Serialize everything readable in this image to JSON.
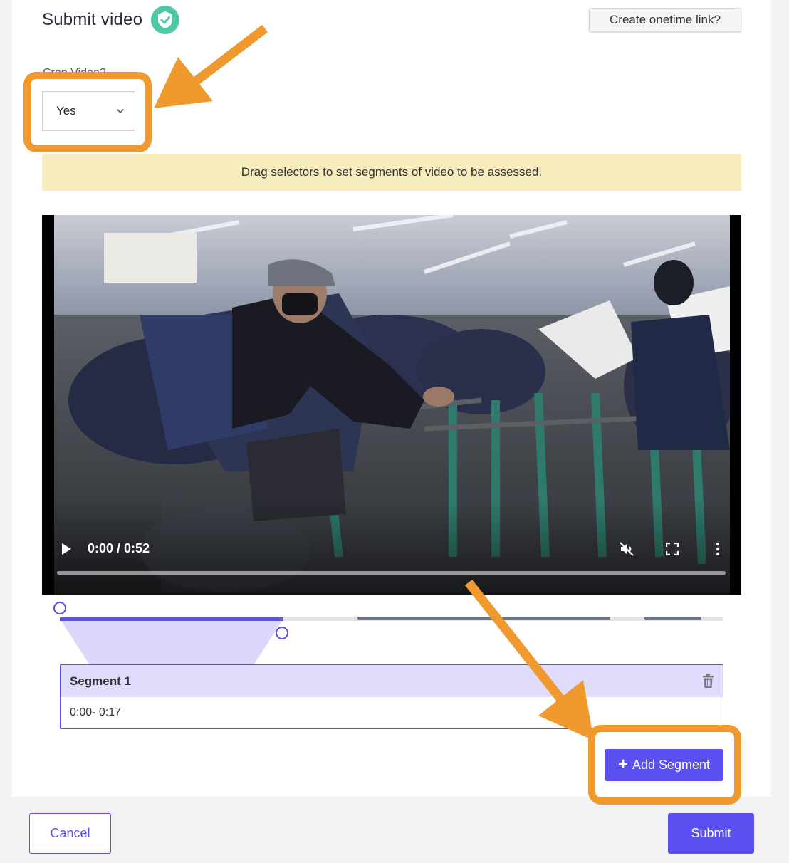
{
  "header": {
    "title": "Submit video",
    "onetime_link_label": "Create onetime link?"
  },
  "form": {
    "field_label": "Crop Video?",
    "select_value": "Yes"
  },
  "hint": "Drag selectors to set segments of video to be assessed.",
  "video": {
    "time_display": "0:00 / 0:52",
    "icons": [
      "play-icon",
      "mute-icon",
      "fullscreen-icon",
      "more-icon"
    ],
    "progress": 0
  },
  "segments": [
    {
      "title": "Segment 1",
      "range": "0:00- 0:17"
    }
  ],
  "actions": {
    "add_segment_label": "Add Segment",
    "add_segment_icon": "+",
    "cancel_label": "Cancel",
    "submit_label": "Submit"
  },
  "colors": {
    "accent": "#5a4ff0",
    "verified": "#4fc9a5",
    "hint_bg": "#f7ecbb",
    "annotation": "#f0992f",
    "segment_header_bg": "#e0dcfb"
  }
}
